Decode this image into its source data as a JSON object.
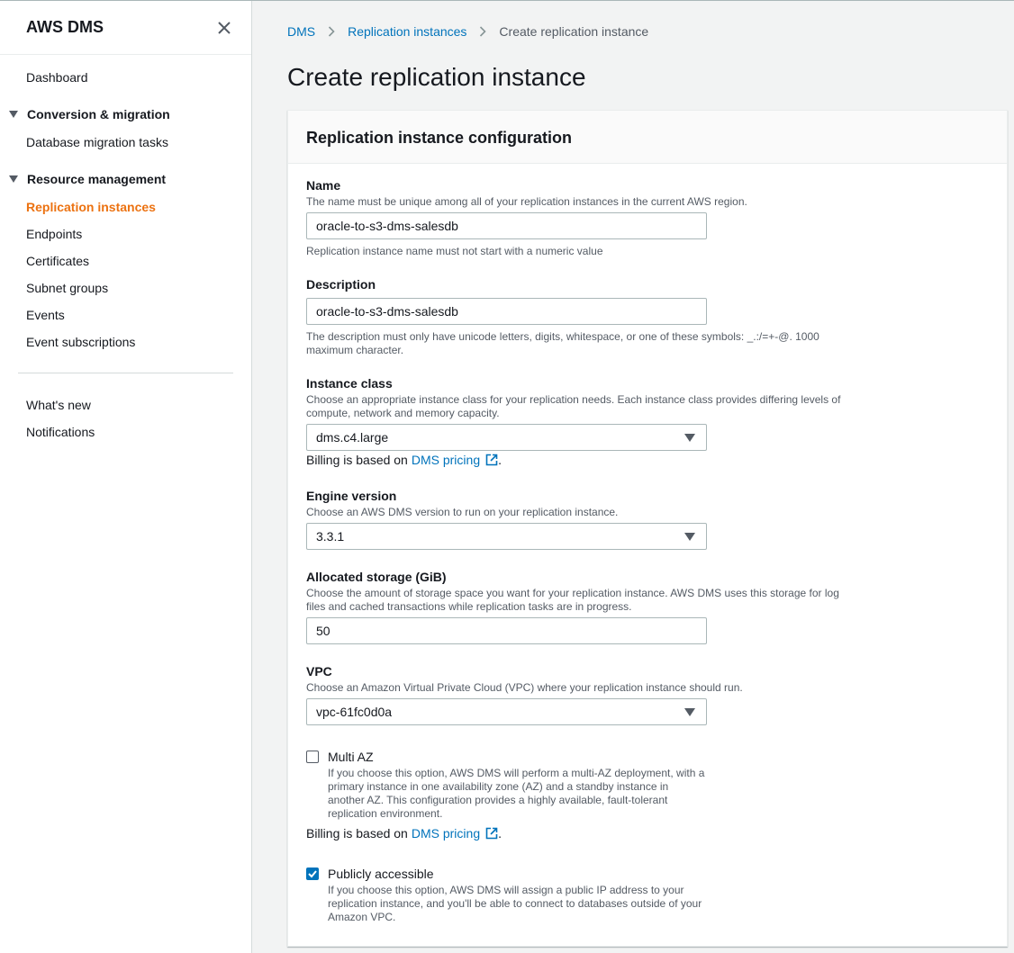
{
  "sidebar": {
    "title": "AWS DMS",
    "items": {
      "dashboard": "Dashboard",
      "section_conversion": "Conversion & migration",
      "database_migration_tasks": "Database migration tasks",
      "section_resource": "Resource management",
      "replication_instances": "Replication instances",
      "endpoints": "Endpoints",
      "certificates": "Certificates",
      "subnet_groups": "Subnet groups",
      "events": "Events",
      "event_subscriptions": "Event subscriptions",
      "whats_new": "What's new",
      "notifications": "Notifications"
    },
    "active_color": "#ec7211"
  },
  "breadcrumb": {
    "root": "DMS",
    "parent": "Replication instances",
    "current": "Create replication instance"
  },
  "page_title": "Create replication instance",
  "panel": {
    "title": "Replication instance configuration",
    "name": {
      "label": "Name",
      "description": "The name must be unique among all of your replication instances in the current AWS region.",
      "value": "oracle-to-s3-dms-salesdb",
      "hint": "Replication instance name must not start with a numeric value"
    },
    "description": {
      "label": "Description",
      "value": "oracle-to-s3-dms-salesdb",
      "hint": "The description must only have unicode letters, digits, whitespace, or one of these symbols: _.:/=+-@. 1000 maximum character."
    },
    "instance_class": {
      "label": "Instance class",
      "description": "Choose an appropriate instance class for your replication needs. Each instance class provides differing levels of compute, network and memory capacity.",
      "value": "dms.c4.large",
      "billing_prefix": "Billing is based on",
      "billing_link": "DMS pricing",
      "billing_suffix": "."
    },
    "engine_version": {
      "label": "Engine version",
      "description": "Choose an AWS DMS version to run on your replication instance.",
      "value": "3.3.1"
    },
    "storage": {
      "label": "Allocated storage (GiB)",
      "description": "Choose the amount of storage space you want for your replication instance. AWS DMS uses this storage for log files and cached transactions while replication tasks are in progress.",
      "value": "50"
    },
    "vpc": {
      "label": "VPC",
      "description": "Choose an Amazon Virtual Private Cloud (VPC) where your replication instance should run.",
      "value": "vpc-61fc0d0a"
    },
    "multi_az": {
      "label": "Multi AZ",
      "checked": false,
      "description": "If you choose this option, AWS DMS will perform a multi-AZ deployment, with a primary instance in one availability zone (AZ) and a standby instance in another AZ. This configuration provides a highly available, fault-tolerant replication environment.",
      "billing_prefix": "Billing is based on",
      "billing_link": "DMS pricing",
      "billing_suffix": "."
    },
    "public": {
      "label": "Publicly accessible",
      "checked": true,
      "description": "If you choose this option, AWS DMS will assign a public IP address to your replication instance, and you'll be able to connect to databases outside of your Amazon VPC."
    }
  },
  "colors": {
    "link": "#0073bb",
    "active": "#ec7211",
    "checkbox_checked": "#0073bb"
  },
  "icons": {
    "close": "close-icon",
    "caret": "caret-down-icon",
    "external": "external-link-icon",
    "breadcrumb_sep": "chevron-right-icon",
    "check": "check-icon"
  }
}
